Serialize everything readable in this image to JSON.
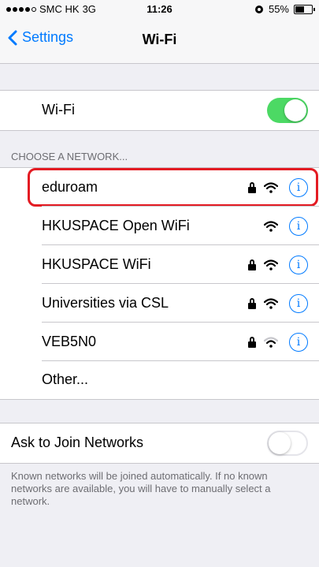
{
  "status_bar": {
    "carrier": "SMC HK",
    "network": "3G",
    "time": "11:26",
    "battery": "55%",
    "battery_level": 0.55,
    "signal_bars_filled": 4,
    "signal_bars_total": 5
  },
  "nav": {
    "back_label": "Settings",
    "title": "Wi-Fi"
  },
  "wifi_toggle": {
    "label": "Wi-Fi",
    "on": true,
    "on_color": "#4cd964"
  },
  "section_header": "CHOOSE A NETWORK...",
  "networks": [
    {
      "name": "eduroam",
      "locked": true,
      "signal": "full",
      "highlighted": true
    },
    {
      "name": "HKUSPACE Open WiFi",
      "locked": false,
      "signal": "full"
    },
    {
      "name": "HKUSPACE WiFi",
      "locked": true,
      "signal": "full"
    },
    {
      "name": "Universities via CSL",
      "locked": true,
      "signal": "full"
    },
    {
      "name": "VEB5N0",
      "locked": true,
      "signal": "medium"
    }
  ],
  "other_label": "Other...",
  "ask_to_join": {
    "label": "Ask to Join Networks",
    "on": false
  },
  "footer": "Known networks will be joined automatically. If no known networks are available, you will have to manually select a network.",
  "colors": {
    "accent": "#007aff",
    "highlight": "#e31b23",
    "background": "#efeff4"
  }
}
